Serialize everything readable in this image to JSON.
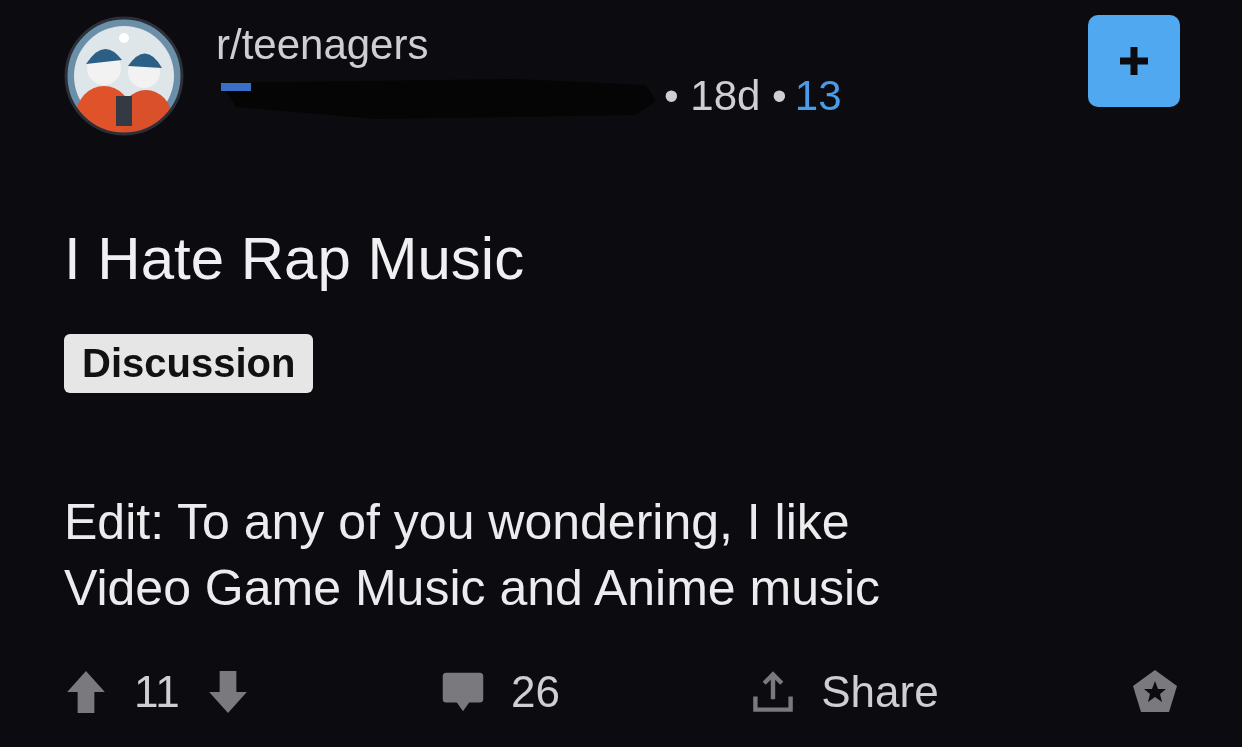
{
  "post": {
    "subreddit": "r/teenagers",
    "age": "• 18d •",
    "award_count": "13",
    "title": "I Hate Rap Music",
    "flair": "Discussion",
    "body": [
      "Edit: To any of you wondering, I like",
      "Video Game Music and Anime music"
    ]
  },
  "actions": {
    "upvotes": "11",
    "comments": "26",
    "share": "Share"
  }
}
